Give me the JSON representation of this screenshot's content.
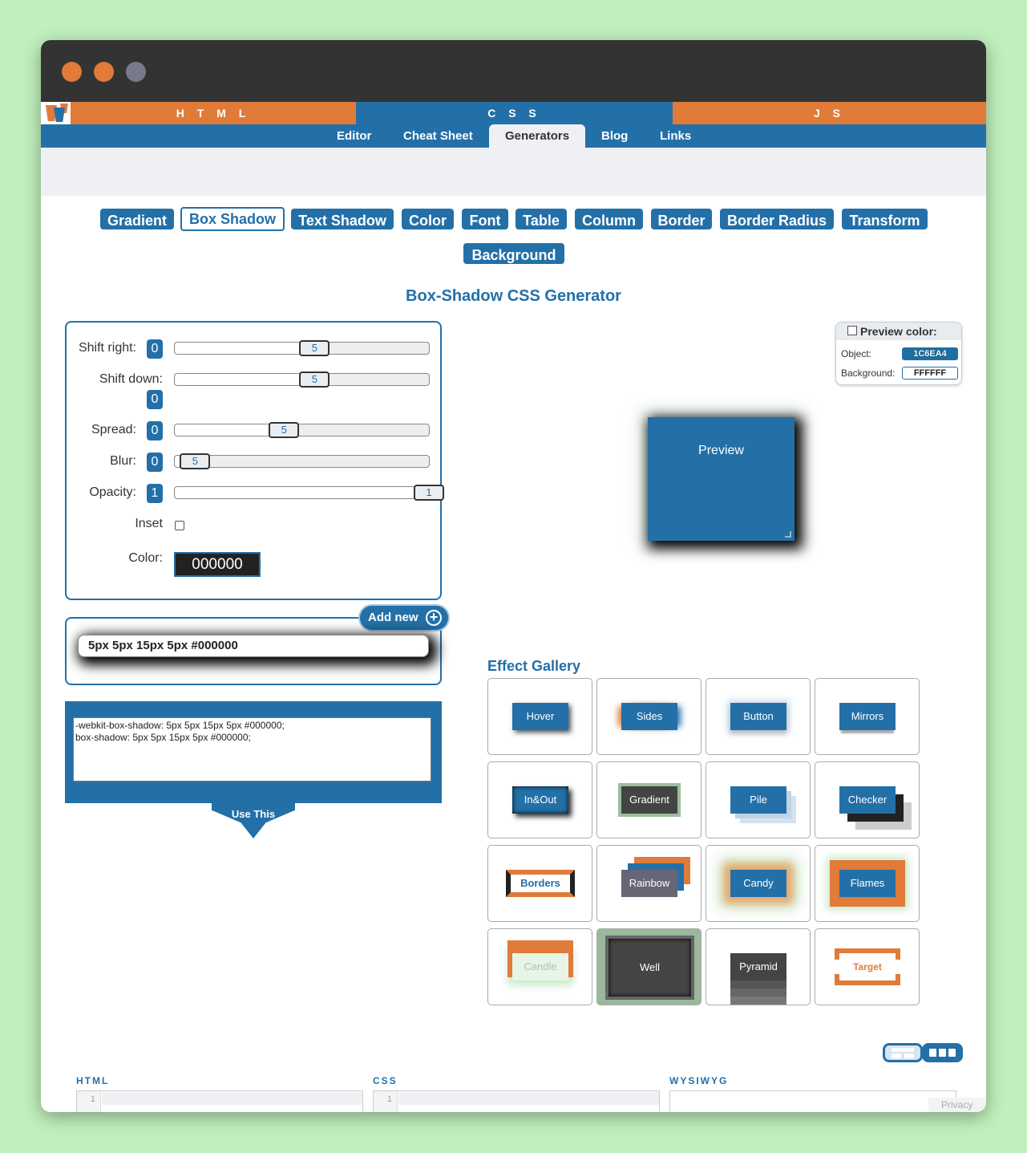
{
  "tabs": {
    "html": "H T M L",
    "css": "C S S",
    "js": "J S"
  },
  "subnav": [
    "Editor",
    "Cheat Sheet",
    "Generators",
    "Blog",
    "Links"
  ],
  "generators": [
    "Gradient",
    "Box Shadow",
    "Text Shadow",
    "Color",
    "Font",
    "Table",
    "Column",
    "Border",
    "Border Radius",
    "Transform",
    "Background"
  ],
  "title": "Box-Shadow CSS Generator",
  "controls": {
    "shift_right": {
      "label": "Shift right:",
      "value": "0",
      "slider": "5",
      "level": 0.55
    },
    "shift_down": {
      "label": "Shift down:",
      "value": "0",
      "slider": "5",
      "level": 0.55
    },
    "spread": {
      "label": "Spread:",
      "value": "0",
      "slider": "5",
      "level": 0.43
    },
    "blur": {
      "label": "Blur:",
      "value": "0",
      "slider": "5",
      "level": 0.08
    },
    "opacity": {
      "label": "Opacity:",
      "value": "1",
      "slider": "1",
      "level": 1.0
    },
    "inset": {
      "label": "Inset"
    },
    "color": {
      "label": "Color:",
      "value": "000000"
    }
  },
  "add_new": "Add new",
  "shadow_item": "5px 5px 15px 5px #000000",
  "code": [
    "-webkit-box-shadow: 5px 5px 15px 5px #000000;",
    "box-shadow: 5px 5px 15px 5px #000000;"
  ],
  "use_this": "Use This",
  "preview_color": {
    "title": "Preview color:",
    "object_label": "Object:",
    "object_value": "1C6EA4",
    "background_label": "Background:",
    "background_value": "FFFFFF"
  },
  "preview_text": "Preview",
  "gallery_title": "Effect Gallery",
  "gallery": [
    "Hover",
    "Sides",
    "Button",
    "Mirrors",
    "In&Out",
    "Gradient",
    "Pile",
    "Checker",
    "Borders",
    "Rainbow",
    "Candy",
    "Flames",
    "Candle",
    "Well",
    "Pyramid",
    "Target"
  ],
  "editors": [
    "HTML",
    "CSS",
    "WYSIWYG"
  ],
  "line_number": "1",
  "privacy": "Privacy",
  "colors": {
    "accent": "#2370a8",
    "orange": "#e07b39",
    "titlebar": "#333333"
  }
}
